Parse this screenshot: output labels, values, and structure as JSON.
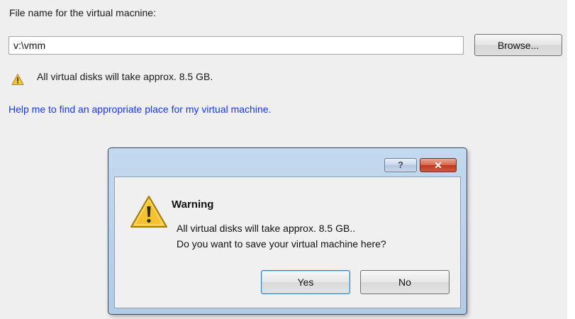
{
  "file_section": {
    "label": "File name for the virtual macnine:",
    "path_value": "v:\\vmm",
    "browse_label": "Browse..."
  },
  "notice": {
    "icon": "warning-icon",
    "text": "All virtual disks will take approx. 8.5 GB."
  },
  "help_link": "Help me to find an appropriate place for my virtual machine.",
  "dialog": {
    "help_button": "?",
    "close_button": "✕",
    "icon": "warning-icon",
    "title": "Warning",
    "line1": "All virtual disks will take approx. 8.5 GB..",
    "line2": "Do you want to save your virtual machine here?",
    "yes_label": "Yes",
    "no_label": "No"
  },
  "colors": {
    "link": "#1a38e6",
    "warning_fill": "#f7c531",
    "close_button": "#c0391f"
  }
}
